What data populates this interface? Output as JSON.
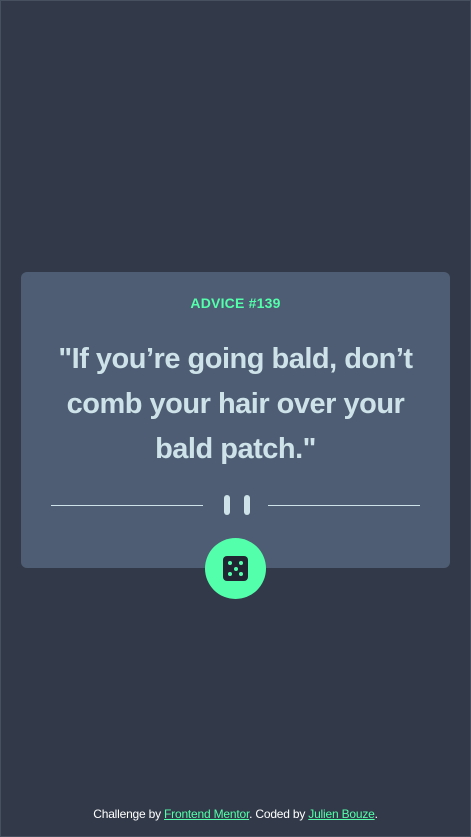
{
  "advice": {
    "label": "ADVICE #139",
    "quote": "\"If you’re going bald, don’t comb your hair over your bald patch.\""
  },
  "dice_button": {
    "icon": "dice-icon"
  },
  "footer": {
    "challenge_prefix": "Challenge by ",
    "challenge_link": "Frontend Mentor",
    "coded_prefix": ". Coded by ",
    "author_link": "Julien Bouze",
    "suffix": "."
  },
  "colors": {
    "background": "#323a49",
    "card": "#4e5d73",
    "accent": "#53ffaa",
    "text": "#cee3e9"
  }
}
